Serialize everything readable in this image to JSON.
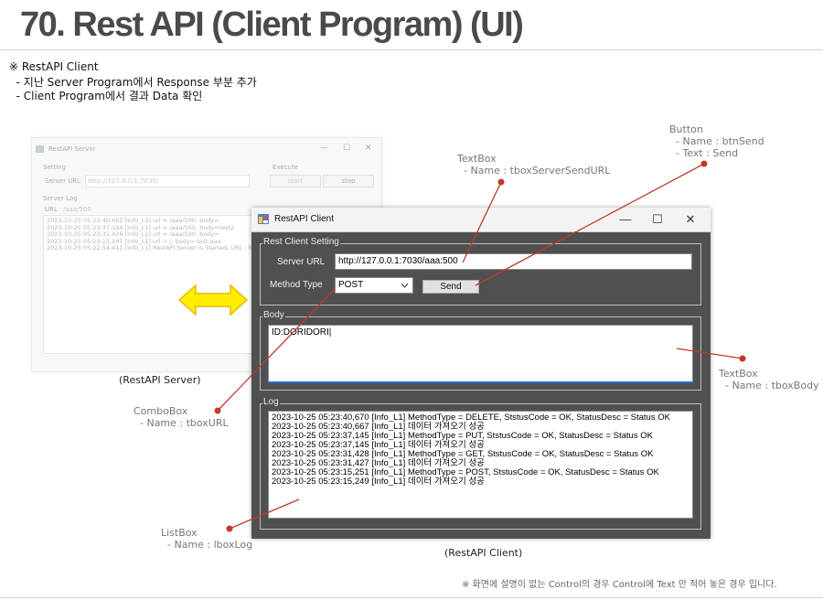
{
  "slide": {
    "title": "70. Rest API (Client Program) (UI)",
    "intro": [
      "※ RestAPI Client",
      "  - 지난 Server Program에서 Response 부분 추가",
      "  - Client Program에서 결과 Data 확인"
    ],
    "footnote": "※ 화면에 설명이 없는 Control의 경우 Control에 Text 만 적어 놓은 경우 입니다.",
    "captions": {
      "server": "(RestAPI Server)",
      "client": "(RestAPI Client)"
    }
  },
  "annotations": {
    "button": [
      "Button",
      "  - Name : btnSend",
      "  - Text : Send"
    ],
    "textbox_url": [
      "TextBox",
      "  - Name : tboxServerSendURL"
    ],
    "textbox_body": [
      "TextBox",
      "  - Name : tboxBody"
    ],
    "combobox": [
      "ComboBox",
      "  - Name : tboxURL"
    ],
    "listbox": [
      "ListBox",
      "  - Name : lboxLog"
    ]
  },
  "server_window": {
    "title": "RestAPI Server",
    "setting_label": "Setting",
    "server_url_label": "Server URL",
    "server_url_value": "http://127.0.0.1:7030/",
    "execute_label": "Execute",
    "start_label": "start",
    "stop_label": "stop",
    "server_log_label": "Server Log",
    "url_label": "URL",
    "url_value": "/aaa/500",
    "log_lines": [
      "2023-10-25 05:23:40,662 [Info_L1] url = /aaa/500, body=",
      "2023-10-25 05:23:37,144 [Info_L1] url = /aaa/500, body=test2",
      "2023-10-25 05:23:31,426 [Info_L1] url = /aaa/500, body=",
      "2023-10-25 05:23:15,247 [Info_L1] url = /, body= test:aaa",
      "2023-10-25 05:22:54,411 [Info_L1] RestAPI Server is Started, URL : http://"
    ],
    "minimize": "—",
    "maximize": "☐",
    "close": "✕"
  },
  "client_window": {
    "title": "RestAPI Client",
    "minimize": "—",
    "maximize": "☐",
    "close": "✕",
    "setting_group": "Rest Client Setting",
    "server_url_label": "Server URL",
    "server_url_value": "http://127.0.0.1:7030/aaa:500",
    "method_type_label": "Method Type",
    "method_selected": "POST",
    "send_label": "Send",
    "body_group": "Body",
    "body_value": "ID:DORIDORI|",
    "log_group": "Log",
    "log_lines": [
      "2023-10-25 05:23:40,670 [Info_L1] MethodType = DELETE, StstusCode = OK, StatusDesc = Status OK",
      "2023-10-25 05:23:40,667 [Info_L1] 데이터 가져오기 성공",
      "2023-10-25 05:23:37,145 [Info_L1] MethodType = PUT, StstusCode = OK, StatusDesc = Status OK",
      "2023-10-25 05:23:37,145 [Info_L1] 데이터 가져오기 성공",
      "2023-10-25 05:23:31,428 [Info_L1] MethodType = GET, StstusCode = OK, StatusDesc = Status OK",
      "2023-10-25 05:23:31,427 [Info_L1] 데이터 가져오기 성공",
      "2023-10-25 05:23:15,251 [Info_L1] MethodType = POST, StstusCode = OK, StatusDesc = Status OK",
      "2023-10-25 05:23:15,249 [Info_L1] 데이터 가져오기 성공"
    ]
  },
  "colors": {
    "annotation_line": "#c0392b",
    "arrow_fill": "#ffee00",
    "arrow_stroke": "#e6b800",
    "client_bg": "#505050",
    "body_focus_border": "#2b6cd0"
  }
}
